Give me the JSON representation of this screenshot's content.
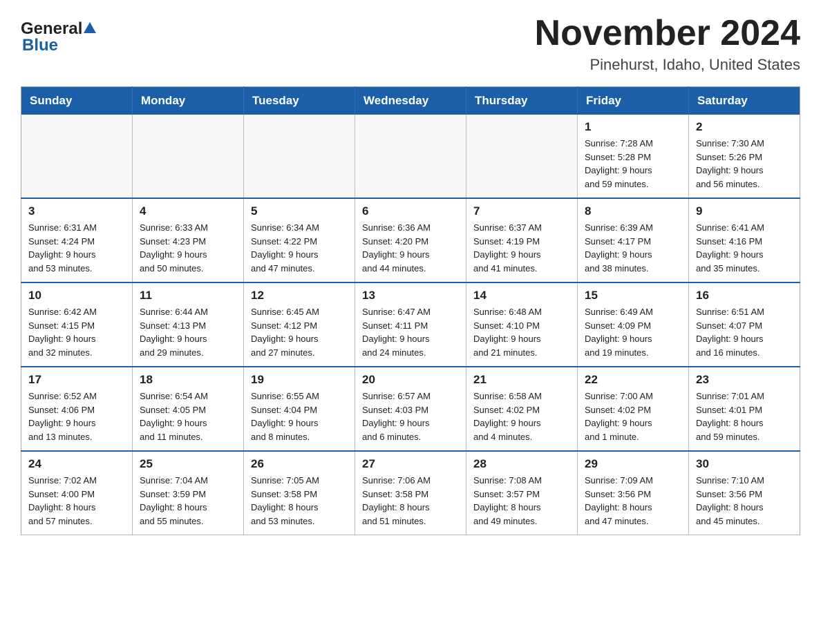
{
  "logo": {
    "general": "General",
    "blue": "Blue",
    "arrow": "▲"
  },
  "title": "November 2024",
  "subtitle": "Pinehurst, Idaho, United States",
  "weekdays": [
    "Sunday",
    "Monday",
    "Tuesday",
    "Wednesday",
    "Thursday",
    "Friday",
    "Saturday"
  ],
  "weeks": [
    [
      {
        "day": "",
        "info": ""
      },
      {
        "day": "",
        "info": ""
      },
      {
        "day": "",
        "info": ""
      },
      {
        "day": "",
        "info": ""
      },
      {
        "day": "",
        "info": ""
      },
      {
        "day": "1",
        "info": "Sunrise: 7:28 AM\nSunset: 5:28 PM\nDaylight: 9 hours\nand 59 minutes."
      },
      {
        "day": "2",
        "info": "Sunrise: 7:30 AM\nSunset: 5:26 PM\nDaylight: 9 hours\nand 56 minutes."
      }
    ],
    [
      {
        "day": "3",
        "info": "Sunrise: 6:31 AM\nSunset: 4:24 PM\nDaylight: 9 hours\nand 53 minutes."
      },
      {
        "day": "4",
        "info": "Sunrise: 6:33 AM\nSunset: 4:23 PM\nDaylight: 9 hours\nand 50 minutes."
      },
      {
        "day": "5",
        "info": "Sunrise: 6:34 AM\nSunset: 4:22 PM\nDaylight: 9 hours\nand 47 minutes."
      },
      {
        "day": "6",
        "info": "Sunrise: 6:36 AM\nSunset: 4:20 PM\nDaylight: 9 hours\nand 44 minutes."
      },
      {
        "day": "7",
        "info": "Sunrise: 6:37 AM\nSunset: 4:19 PM\nDaylight: 9 hours\nand 41 minutes."
      },
      {
        "day": "8",
        "info": "Sunrise: 6:39 AM\nSunset: 4:17 PM\nDaylight: 9 hours\nand 38 minutes."
      },
      {
        "day": "9",
        "info": "Sunrise: 6:41 AM\nSunset: 4:16 PM\nDaylight: 9 hours\nand 35 minutes."
      }
    ],
    [
      {
        "day": "10",
        "info": "Sunrise: 6:42 AM\nSunset: 4:15 PM\nDaylight: 9 hours\nand 32 minutes."
      },
      {
        "day": "11",
        "info": "Sunrise: 6:44 AM\nSunset: 4:13 PM\nDaylight: 9 hours\nand 29 minutes."
      },
      {
        "day": "12",
        "info": "Sunrise: 6:45 AM\nSunset: 4:12 PM\nDaylight: 9 hours\nand 27 minutes."
      },
      {
        "day": "13",
        "info": "Sunrise: 6:47 AM\nSunset: 4:11 PM\nDaylight: 9 hours\nand 24 minutes."
      },
      {
        "day": "14",
        "info": "Sunrise: 6:48 AM\nSunset: 4:10 PM\nDaylight: 9 hours\nand 21 minutes."
      },
      {
        "day": "15",
        "info": "Sunrise: 6:49 AM\nSunset: 4:09 PM\nDaylight: 9 hours\nand 19 minutes."
      },
      {
        "day": "16",
        "info": "Sunrise: 6:51 AM\nSunset: 4:07 PM\nDaylight: 9 hours\nand 16 minutes."
      }
    ],
    [
      {
        "day": "17",
        "info": "Sunrise: 6:52 AM\nSunset: 4:06 PM\nDaylight: 9 hours\nand 13 minutes."
      },
      {
        "day": "18",
        "info": "Sunrise: 6:54 AM\nSunset: 4:05 PM\nDaylight: 9 hours\nand 11 minutes."
      },
      {
        "day": "19",
        "info": "Sunrise: 6:55 AM\nSunset: 4:04 PM\nDaylight: 9 hours\nand 8 minutes."
      },
      {
        "day": "20",
        "info": "Sunrise: 6:57 AM\nSunset: 4:03 PM\nDaylight: 9 hours\nand 6 minutes."
      },
      {
        "day": "21",
        "info": "Sunrise: 6:58 AM\nSunset: 4:02 PM\nDaylight: 9 hours\nand 4 minutes."
      },
      {
        "day": "22",
        "info": "Sunrise: 7:00 AM\nSunset: 4:02 PM\nDaylight: 9 hours\nand 1 minute."
      },
      {
        "day": "23",
        "info": "Sunrise: 7:01 AM\nSunset: 4:01 PM\nDaylight: 8 hours\nand 59 minutes."
      }
    ],
    [
      {
        "day": "24",
        "info": "Sunrise: 7:02 AM\nSunset: 4:00 PM\nDaylight: 8 hours\nand 57 minutes."
      },
      {
        "day": "25",
        "info": "Sunrise: 7:04 AM\nSunset: 3:59 PM\nDaylight: 8 hours\nand 55 minutes."
      },
      {
        "day": "26",
        "info": "Sunrise: 7:05 AM\nSunset: 3:58 PM\nDaylight: 8 hours\nand 53 minutes."
      },
      {
        "day": "27",
        "info": "Sunrise: 7:06 AM\nSunset: 3:58 PM\nDaylight: 8 hours\nand 51 minutes."
      },
      {
        "day": "28",
        "info": "Sunrise: 7:08 AM\nSunset: 3:57 PM\nDaylight: 8 hours\nand 49 minutes."
      },
      {
        "day": "29",
        "info": "Sunrise: 7:09 AM\nSunset: 3:56 PM\nDaylight: 8 hours\nand 47 minutes."
      },
      {
        "day": "30",
        "info": "Sunrise: 7:10 AM\nSunset: 3:56 PM\nDaylight: 8 hours\nand 45 minutes."
      }
    ]
  ]
}
